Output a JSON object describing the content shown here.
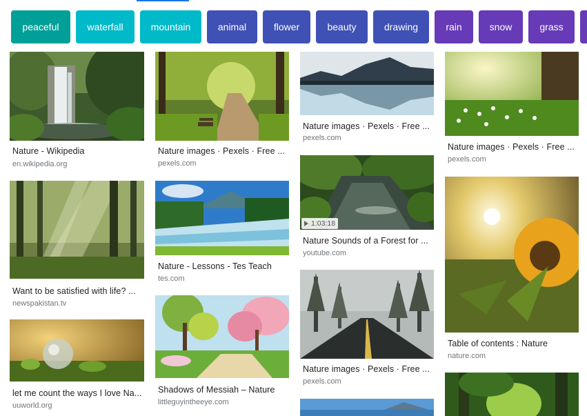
{
  "chips": [
    {
      "label": "peaceful",
      "color": "#00a098"
    },
    {
      "label": "waterfall",
      "color": "#00b9c9"
    },
    {
      "label": "mountain",
      "color": "#00b9c9"
    },
    {
      "label": "animal",
      "color": "#3f51b5"
    },
    {
      "label": "flower",
      "color": "#3f51b5"
    },
    {
      "label": "beauty",
      "color": "#3f51b5"
    },
    {
      "label": "drawing",
      "color": "#3f51b5"
    },
    {
      "label": "rain",
      "color": "#673ab7"
    },
    {
      "label": "snow",
      "color": "#673ab7"
    },
    {
      "label": "grass",
      "color": "#673ab7"
    }
  ],
  "results": [
    {
      "title": "Nature - Wikipedia",
      "source": "en.wikipedia.org",
      "image": "waterfall-forest-image"
    },
    {
      "title": "Want to be satisfied with life? ...",
      "source": "newspakistan.tv",
      "image": "forest-sunrays-image"
    },
    {
      "title": "let me count the ways I love Na...",
      "source": "uuworld.org",
      "image": "glass-globe-moss-image"
    },
    {
      "title": "Nature images · Pexels · Free ...",
      "source": "pexels.com",
      "image": "park-path-bench-image"
    },
    {
      "title": "Nature - Lessons - Tes Teach",
      "source": "tes.com",
      "image": "mountain-river-image"
    },
    {
      "title": "Shadows of Messiah – Nature",
      "source": "littleguyintheeye.com",
      "image": "painted-spring-trees-image"
    },
    {
      "title": "Nature images · Pexels · Free ...",
      "source": "pexels.com",
      "image": "mountain-lake-reflection-image"
    },
    {
      "title": "Nature Sounds of a Forest for ...",
      "source": "youtube.com",
      "image": "forest-stream-image",
      "duration": "1:03:18"
    },
    {
      "title": "Nature images · Pexels · Free ...",
      "source": "pexels.com",
      "image": "misty-road-trees-image"
    },
    {
      "title": "",
      "source": "",
      "image": "lake-mountains-image"
    },
    {
      "title": "Nature images · Pexels · Free ...",
      "source": "pexels.com",
      "image": "sunny-meadow-daisies-image"
    },
    {
      "title": "Table of contents : Nature",
      "source": "nature.com",
      "image": "sunflower-sunset-image"
    },
    {
      "title": "",
      "source": "",
      "image": "green-forest-image"
    }
  ]
}
